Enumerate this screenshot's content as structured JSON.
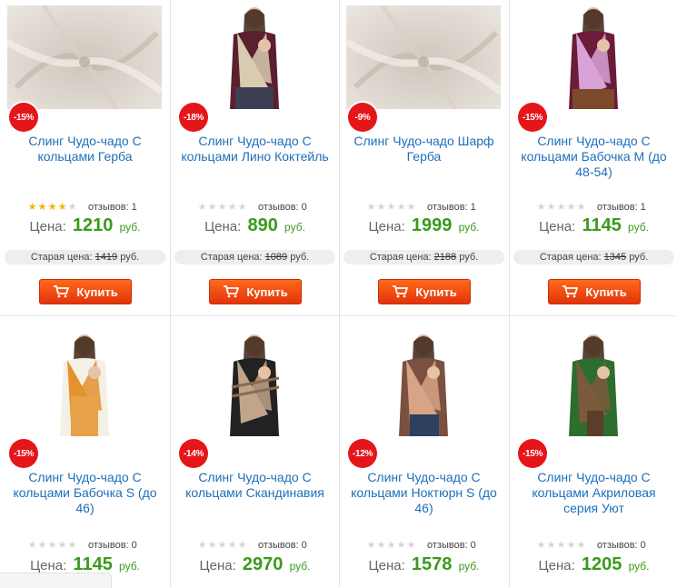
{
  "labels": {
    "reviews": "отзывов:",
    "price": "Цена:",
    "currency": "руб.",
    "old_price": "Старая цена:",
    "buy": "Купить"
  },
  "colors": {
    "badge": "#e5161a",
    "title": "#1f6fb8",
    "price": "#3a9a1c",
    "button": "#f04a10"
  },
  "products": [
    {
      "badge": "-15%",
      "title1": "Слинг Чудо-чадо С",
      "title2": "кольцами Герба",
      "title3": "",
      "rating": 4,
      "reviews": "1",
      "price": "1210",
      "old_price": "1419",
      "image": "fabric-beige"
    },
    {
      "badge": "-18%",
      "title1": "Слинг Чудо-чадо С",
      "title2": "кольцами Лино Коктейль",
      "title3": "",
      "rating": 0,
      "reviews": "0",
      "price": "890",
      "old_price": "1089",
      "image": "woman-beige-sling"
    },
    {
      "badge": "-9%",
      "title1": "Слинг Чудо-чадо Шарф",
      "title2": "Герба",
      "title3": "",
      "rating": 0,
      "reviews": "1",
      "price": "1999",
      "old_price": "2188",
      "image": "fabric-beige"
    },
    {
      "badge": "-15%",
      "title1": "Слинг Чудо-чадо С",
      "title2": "кольцами Бабочка М (до",
      "title3": "48-54)",
      "rating": 0,
      "reviews": "1",
      "price": "1145",
      "old_price": "1345",
      "image": "woman-pink-sling"
    },
    {
      "badge": "-15%",
      "title1": "Слинг Чудо-чадо С",
      "title2": "кольцами Бабочка S (до",
      "title3": "46)",
      "rating": 0,
      "reviews": "0",
      "price": "1145",
      "old_price": "",
      "image": "woman-orange-sling"
    },
    {
      "badge": "-14%",
      "title1": "Слинг Чудо-чадо С",
      "title2": "кольцами Скандинавия",
      "title3": "",
      "rating": 0,
      "reviews": "0",
      "price": "2970",
      "old_price": "",
      "image": "woman-striped-sling"
    },
    {
      "badge": "-12%",
      "title1": "Слинг Чудо-чадо С",
      "title2": "кольцами Ноктюрн S (до",
      "title3": "46)",
      "rating": 0,
      "reviews": "0",
      "price": "1578",
      "old_price": "",
      "image": "woman-tan-sling"
    },
    {
      "badge": "-15%",
      "title1": "Слинг Чудо-чадо С",
      "title2": "кольцами Акриловая",
      "title3": "серия Уют",
      "rating": 0,
      "reviews": "0",
      "price": "1205",
      "old_price": "",
      "image": "woman-brown-sling"
    }
  ]
}
